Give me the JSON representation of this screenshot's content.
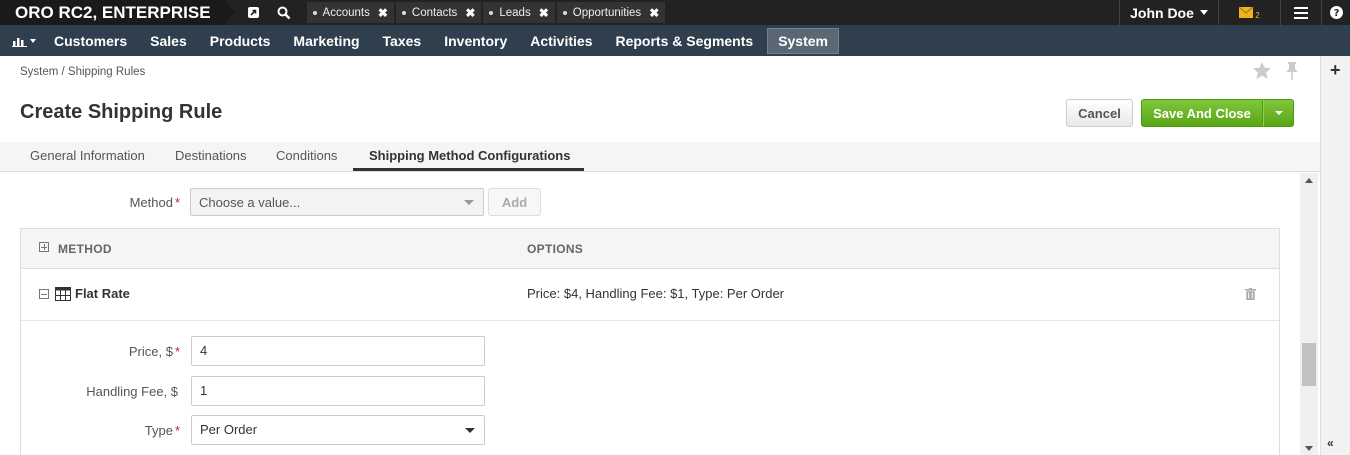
{
  "app": {
    "brand": "ORO RC2, ENTERPRISE"
  },
  "top_tabs": [
    {
      "label": "Accounts"
    },
    {
      "label": "Contacts"
    },
    {
      "label": "Leads"
    },
    {
      "label": "Opportunities"
    }
  ],
  "user": {
    "name": "John Doe",
    "mail_count": "2"
  },
  "main_nav": [
    {
      "label": "Customers"
    },
    {
      "label": "Sales"
    },
    {
      "label": "Products"
    },
    {
      "label": "Marketing"
    },
    {
      "label": "Taxes"
    },
    {
      "label": "Inventory"
    },
    {
      "label": "Activities"
    },
    {
      "label": "Reports & Segments"
    },
    {
      "label": "System",
      "active": true
    }
  ],
  "breadcrumb": "System / Shipping Rules",
  "page_title": "Create Shipping Rule",
  "actions": {
    "cancel": "Cancel",
    "save": "Save And Close"
  },
  "tabs": [
    {
      "label": "General Information"
    },
    {
      "label": "Destinations"
    },
    {
      "label": "Conditions"
    },
    {
      "label": "Shipping Method Configurations",
      "active": true
    }
  ],
  "method_select": {
    "label": "Method",
    "placeholder": "Choose a value...",
    "add_label": "Add"
  },
  "grid": {
    "headers": {
      "method": "METHOD",
      "options": "OPTIONS"
    },
    "rows": [
      {
        "method": "Flat Rate",
        "options": "Price: $4, Handling Fee: $1, Type: Per Order"
      }
    ]
  },
  "flat_rate_form": {
    "price": {
      "label": "Price, $",
      "value": "4"
    },
    "handling_fee": {
      "label": "Handling Fee, $",
      "value": "1"
    },
    "type": {
      "label": "Type",
      "value": "Per Order"
    }
  },
  "colors": {
    "topbar": "#222222",
    "nav": "#2f3f4e",
    "save_green": "#6cb52a",
    "required": "#c81e1e"
  }
}
